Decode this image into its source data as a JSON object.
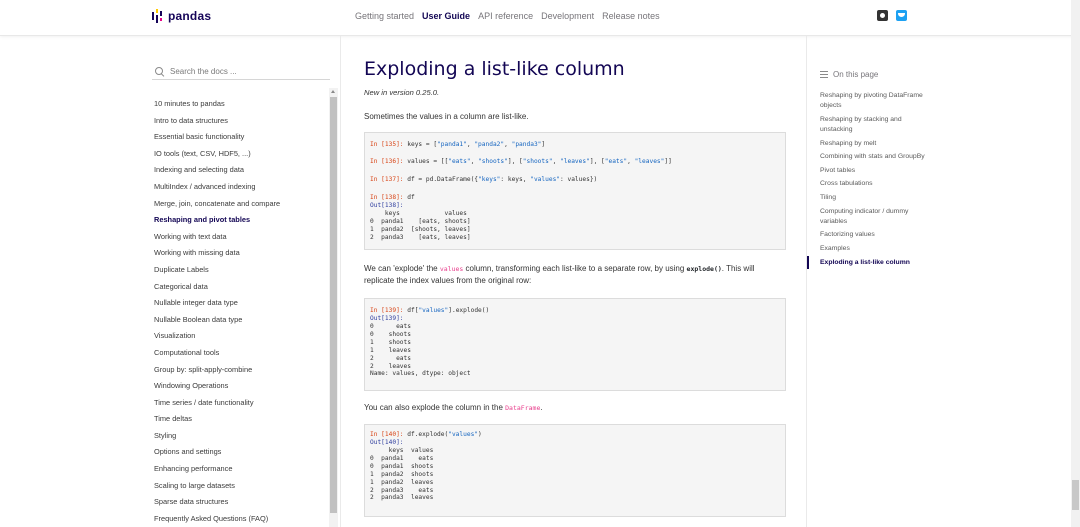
{
  "navbar": {
    "logo_text": "pandas",
    "links": [
      {
        "label": "Getting started",
        "active": false
      },
      {
        "label": "User Guide",
        "active": true
      },
      {
        "label": "API reference",
        "active": false
      },
      {
        "label": "Development",
        "active": false
      },
      {
        "label": "Release notes",
        "active": false
      }
    ],
    "icons": [
      "github-icon",
      "twitter-icon"
    ]
  },
  "sidebar": {
    "search_placeholder": "Search the docs ...",
    "items": [
      {
        "label": "10 minutes to pandas"
      },
      {
        "label": "Intro to data structures"
      },
      {
        "label": "Essential basic functionality"
      },
      {
        "label": "IO tools (text, CSV, HDF5, ...)"
      },
      {
        "label": "Indexing and selecting data"
      },
      {
        "label": "MultiIndex / advanced indexing"
      },
      {
        "label": "Merge, join, concatenate and compare"
      },
      {
        "label": "Reshaping and pivot tables",
        "active": true
      },
      {
        "label": "Working with text data"
      },
      {
        "label": "Working with missing data"
      },
      {
        "label": "Duplicate Labels"
      },
      {
        "label": "Categorical data"
      },
      {
        "label": "Nullable integer data type"
      },
      {
        "label": "Nullable Boolean data type"
      },
      {
        "label": "Visualization"
      },
      {
        "label": "Computational tools"
      },
      {
        "label": "Group by: split-apply-combine"
      },
      {
        "label": "Windowing Operations"
      },
      {
        "label": "Time series / date functionality"
      },
      {
        "label": "Time deltas"
      },
      {
        "label": "Styling"
      },
      {
        "label": "Options and settings"
      },
      {
        "label": "Enhancing performance"
      },
      {
        "label": "Scaling to large datasets"
      },
      {
        "label": "Sparse data structures"
      },
      {
        "label": "Frequently Asked Questions (FAQ)"
      }
    ]
  },
  "main": {
    "title": "Exploding a list-like column",
    "version_note": "New in version 0.25.0.",
    "para1": "Sometimes the values in a column are list-like.",
    "para2_a": "We can 'explode' the ",
    "para2_code1": "values",
    "para2_b": " column, transforming each list-like to a separate row, by using ",
    "para2_code2": "explode()",
    "para2_c": ". This will replicate the index values from the original row:",
    "para3_a": "You can also explode the column in the ",
    "para3_code": "DataFrame",
    "para3_b": ".",
    "code1": {
      "p135": "In [135]:",
      "c135_a": " keys = [",
      "c135_s1": "\"panda1\"",
      "c135_s2": "\"panda2\"",
      "c135_s3": "\"panda3\"",
      "p136": "In [136]:",
      "c136_a": " values = [[",
      "c136_s1": "\"eats\"",
      "c136_s2": "\"shoots\"",
      "c136_s3": "\"shoots\"",
      "c136_s4": "\"leaves\"",
      "c136_s5": "\"eats\"",
      "c136_s6": "\"leaves\"",
      "p137": "In [137]:",
      "c137_a": " df = pd.DataFrame({",
      "c137_s1": "\"keys\"",
      "c137_b": ": keys, ",
      "c137_s2": "\"values\"",
      "c137_c": ": values})",
      "p138": "In [138]:",
      "c138": " df",
      "o138": "Out[138]:",
      "output": "    keys            values\n0  panda1    [eats, shoots]\n1  panda2  [shoots, leaves]\n2  panda3    [eats, leaves]"
    },
    "code2": {
      "p139": "In [139]:",
      "c139_a": " df[",
      "c139_s": "\"values\"",
      "c139_b": "].explode()",
      "o139": "Out[139]:",
      "output": "0      eats\n0    shoots\n1    shoots\n1    leaves\n2      eats\n2    leaves\nName: values, dtype: object"
    },
    "code3": {
      "p140": "In [140]:",
      "c140_a": " df.explode(",
      "c140_s": "\"values\"",
      "c140_b": ")",
      "o140": "Out[140]:",
      "output": "     keys  values\n0  panda1    eats\n0  panda1  shoots\n1  panda2  shoots\n1  panda2  leaves\n2  panda3    eats\n2  panda3  leaves"
    }
  },
  "toc": {
    "title": "On this page",
    "items": [
      {
        "label": "Reshaping by pivoting DataFrame objects"
      },
      {
        "label": "Reshaping by stacking and unstacking"
      },
      {
        "label": "Reshaping by melt"
      },
      {
        "label": "Combining with stats and GroupBy"
      },
      {
        "label": "Pivot tables"
      },
      {
        "label": "Cross tabulations"
      },
      {
        "label": "Tiling"
      },
      {
        "label": "Computing indicator / dummy variables"
      },
      {
        "label": "Factorizing values"
      },
      {
        "label": "Examples"
      },
      {
        "label": "Exploding a list-like column",
        "active": true
      }
    ]
  }
}
